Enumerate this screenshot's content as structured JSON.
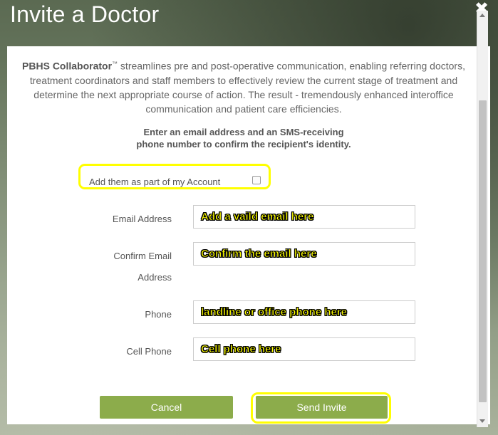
{
  "modal": {
    "title": "Invite a Doctor",
    "close_icon": "close-icon"
  },
  "intro": {
    "brand": "PBHS Collaborator",
    "trademark": "™",
    "text": " streamlines pre and post-operative communication, enabling referring doctors, treatment coordinators and staff members to effectively review the current stage of treatment and determine the next appropriate course of action. The result - tremendously enhanced interoffice communication and patient care efficiencies."
  },
  "instruction": {
    "line1": "Enter an email address and an SMS-receiving",
    "line2": "phone number to confirm the recipient's identity."
  },
  "account_option": {
    "label": "Add them as part of my Account",
    "checked": false
  },
  "form": {
    "email_label": "Email Address",
    "email_value": "Add a vaild email here",
    "confirm_label_1": "Confirm Email",
    "confirm_label_2": "Address",
    "confirm_value": "Confirm the email here",
    "phone_label": "Phone",
    "phone_value": "landline or office phone here",
    "cell_label": "Cell Phone",
    "cell_value": "Cell phone here"
  },
  "buttons": {
    "cancel": "Cancel",
    "send": "Send Invite"
  },
  "colors": {
    "button_green": "#8cac4b",
    "highlight_yellow": "#ffff00"
  }
}
